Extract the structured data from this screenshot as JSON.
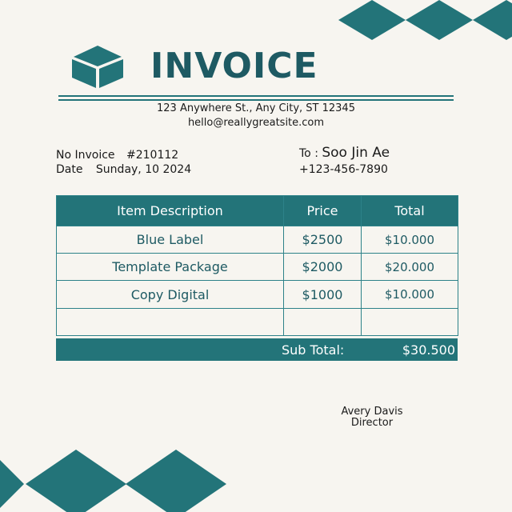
{
  "header": {
    "title": "INVOICE",
    "address": "123 Anywhere St., Any City, ST 12345",
    "email": "hello@reallygreatsite.com"
  },
  "invoice_info": {
    "number_label": "No Invoice",
    "number_value": "#210112",
    "date_label": "Date",
    "date_value": "Sunday, 10 2024"
  },
  "recipient": {
    "to_label": "To :",
    "name": "Soo Jin Ae",
    "phone": "+123-456-7890"
  },
  "table": {
    "headers": [
      "Item Description",
      "Price",
      "Total"
    ],
    "rows": [
      [
        "Blue Label",
        "$2500",
        "$10.000"
      ],
      [
        "Template Package",
        "$2000",
        "$20.000"
      ],
      [
        "Copy Digital",
        "$1000",
        "$10.000"
      ],
      [
        "",
        "",
        ""
      ]
    ]
  },
  "subtotal": {
    "label": "Sub Total:",
    "value": "$30.500"
  },
  "signature": {
    "name": "Avery Davis",
    "title": "Director"
  },
  "colors": {
    "accent": "#237479",
    "title": "#1e5a63",
    "background": "#f7f5f0"
  },
  "icons": [
    "cube-icon"
  ]
}
